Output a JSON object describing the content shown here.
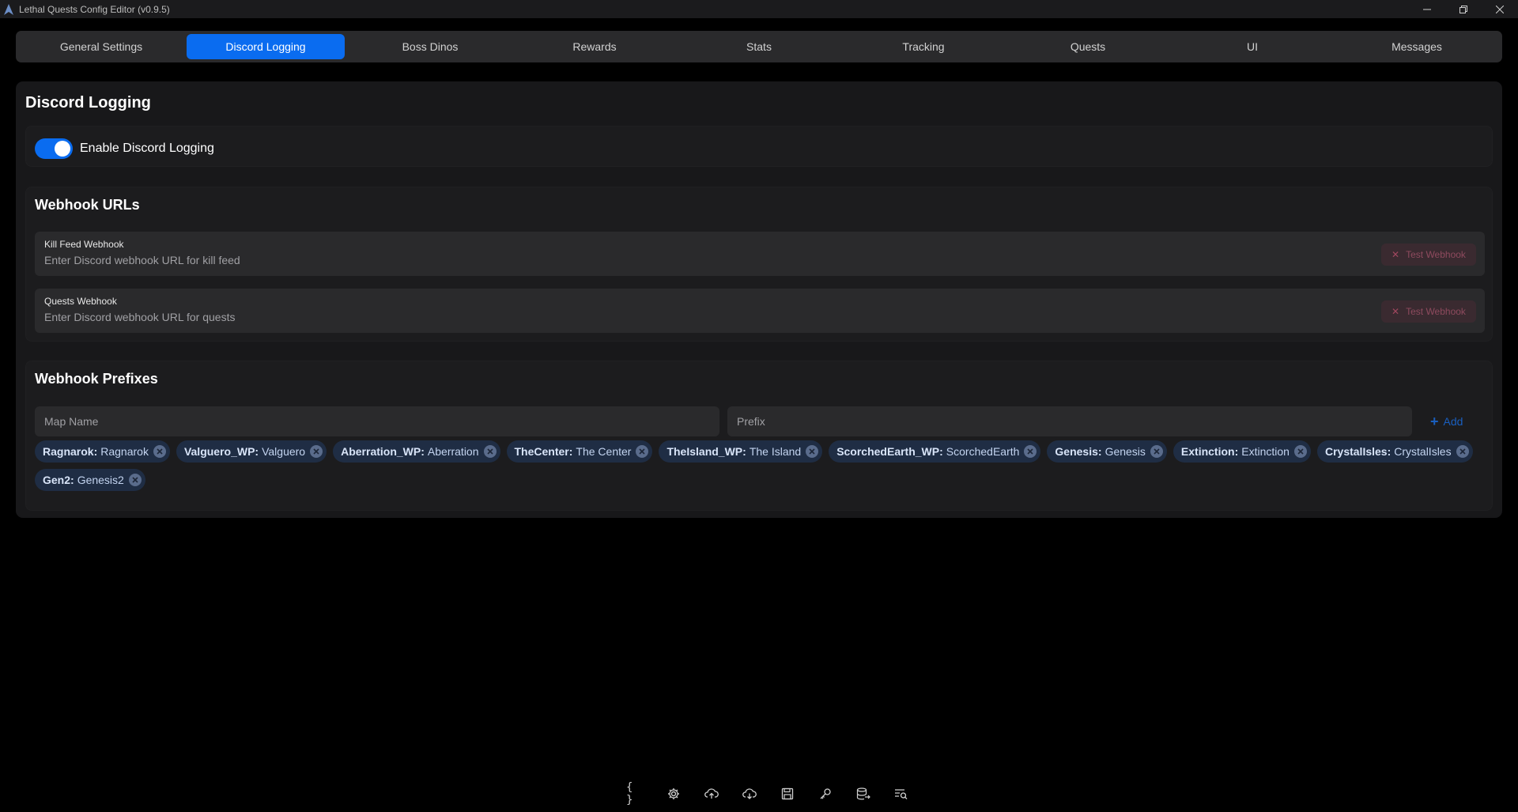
{
  "window": {
    "title": "Lethal Quests Config Editor (v0.9.5)",
    "controls": {
      "minimize": "—",
      "restore": "❐",
      "close": "✕"
    }
  },
  "tabs": [
    {
      "label": "General Settings",
      "active": false
    },
    {
      "label": "Discord Logging",
      "active": true
    },
    {
      "label": "Boss Dinos",
      "active": false
    },
    {
      "label": "Rewards",
      "active": false
    },
    {
      "label": "Stats",
      "active": false
    },
    {
      "label": "Tracking",
      "active": false
    },
    {
      "label": "Quests",
      "active": false
    },
    {
      "label": "UI",
      "active": false
    },
    {
      "label": "Messages",
      "active": false
    }
  ],
  "page": {
    "title": "Discord Logging",
    "enable_toggle": {
      "label": "Enable Discord Logging",
      "on": true
    },
    "webhooks": {
      "title": "Webhook URLs",
      "fields": [
        {
          "label": "Kill Feed Webhook",
          "value": "",
          "placeholder": "Enter Discord webhook URL for kill feed",
          "button": "Test Webhook"
        },
        {
          "label": "Quests Webhook",
          "value": "",
          "placeholder": "Enter Discord webhook URL for quests",
          "button": "Test Webhook"
        }
      ]
    },
    "prefixes": {
      "title": "Webhook Prefixes",
      "map_name_placeholder": "Map Name",
      "prefix_placeholder": "Prefix",
      "add_label": "Add",
      "items": [
        {
          "map": "Ragnarok",
          "prefix": "Ragnarok"
        },
        {
          "map": "Valguero_WP",
          "prefix": "Valguero"
        },
        {
          "map": "Aberration_WP",
          "prefix": "Aberration"
        },
        {
          "map": "TheCenter",
          "prefix": "The Center"
        },
        {
          "map": "TheIsland_WP",
          "prefix": "The Island"
        },
        {
          "map": "ScorchedEarth_WP",
          "prefix": "ScorchedEarth"
        },
        {
          "map": "Genesis",
          "prefix": "Genesis"
        },
        {
          "map": "Extinction",
          "prefix": "Extinction"
        },
        {
          "map": "CrystalIsles",
          "prefix": "CrystalIsles"
        },
        {
          "map": "Gen2",
          "prefix": "Genesis2"
        }
      ]
    }
  },
  "bottom_toolbar": {
    "icons": [
      "json-braces-icon",
      "settings-gear-icon",
      "cloud-upload-icon",
      "cloud-download-icon",
      "save-disk-icon",
      "key-icon",
      "database-export-icon",
      "search-list-icon"
    ]
  },
  "colors": {
    "accent": "#0a6cf0",
    "background": "#000000",
    "panel": "#18181a",
    "chip": "#1f2d44",
    "danger_muted": "#3a2a30"
  }
}
